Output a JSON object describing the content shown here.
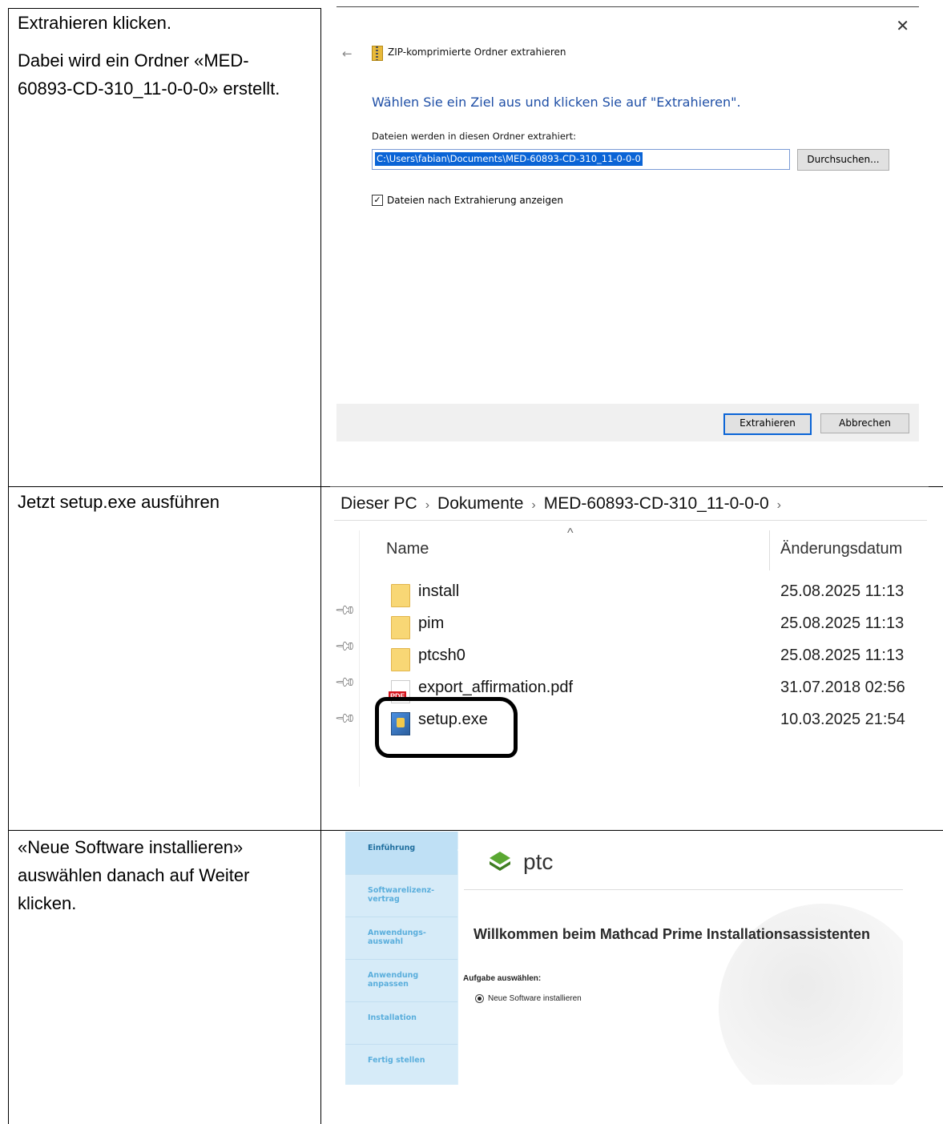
{
  "rows": [
    {
      "instruction": [
        "Extrahieren klicken.",
        "Dabei wird ein Ordner «MED-60893-CD-310_11-0-0-0» erstellt."
      ]
    },
    {
      "instruction": [
        "Jetzt setup.exe ausführen"
      ]
    },
    {
      "instruction": [
        "«Neue Software installieren» auswählen danach auf Weiter klicken."
      ]
    }
  ],
  "zip_dialog": {
    "close_icon": "close-icon",
    "back_icon": "back-arrow-icon",
    "title": "ZIP-komprimierte Ordner extrahieren",
    "heading": "Wählen Sie ein Ziel aus und klicken Sie auf \"Extrahieren\".",
    "folder_label": "Dateien werden in diesen Ordner extrahiert:",
    "path_value": "C:\\Users\\fabian\\Documents\\MED-60893-CD-310_11-0-0-0",
    "browse_label": "Durchsuchen...",
    "show_files_checked": true,
    "show_files_label": "Dateien nach Extrahierung anzeigen",
    "extract_label": "Extrahieren",
    "cancel_label": "Abbrechen"
  },
  "explorer": {
    "breadcrumb": [
      "Dieser PC",
      "Dokumente",
      "MED-60893-CD-310_11-0-0-0"
    ],
    "col_name": "Name",
    "col_date": "Änderungsdatum",
    "files": [
      {
        "name": "install",
        "date": "25.08.2025 11:13",
        "icon": "folder-icon"
      },
      {
        "name": "pim",
        "date": "25.08.2025 11:13",
        "icon": "folder-icon"
      },
      {
        "name": "ptcsh0",
        "date": "25.08.2025 11:13",
        "icon": "folder-icon"
      },
      {
        "name": "export_affirmation.pdf",
        "date": "31.07.2018 02:56",
        "icon": "pdf-icon"
      },
      {
        "name": "setup.exe",
        "date": "10.03.2025 21:54",
        "icon": "setup-icon"
      }
    ],
    "pdf_badge": "PDF"
  },
  "installer": {
    "steps": [
      {
        "label": "Einführung",
        "active": true
      },
      {
        "label": "Softwarelizenz-\nvertrag",
        "active": false
      },
      {
        "label": "Anwendungs-\nauswahl",
        "active": false
      },
      {
        "label": "Anwendung\nanpassen",
        "active": false
      },
      {
        "label": "Installation",
        "active": false
      },
      {
        "label": "Fertig stellen",
        "active": false
      }
    ],
    "logo_text": "ptc",
    "welcome": "Willkommen beim Mathcad Prime Installationsassistenten",
    "task_label": "Aufgabe auswählen:",
    "option_label": "Neue Software installieren",
    "colors": {
      "sidebar": "#dceef9",
      "active_step": "#bfe0f5",
      "logo_green": "#5aa832"
    }
  }
}
